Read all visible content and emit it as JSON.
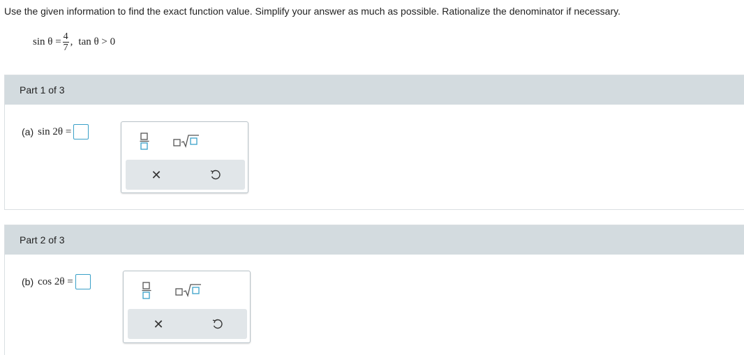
{
  "instructions": "Use the given information to find the exact function value. Simplify your answer as much as possible. Rationalize the denominator if necessary.",
  "given": {
    "lhs": "sin θ =",
    "numerator": "4",
    "denominator": "7",
    "condition": "tan θ > 0"
  },
  "parts": [
    {
      "header": "Part 1 of 3",
      "label": "(a)",
      "expression": "sin 2θ =",
      "answer_value": ""
    },
    {
      "header": "Part 2 of 3",
      "label": "(b)",
      "expression": "cos 2θ =",
      "answer_value": ""
    }
  ],
  "palette_icons": {
    "fraction": "fraction-icon",
    "sqrt": "square-root-icon",
    "clear": "close-icon",
    "undo": "undo-icon"
  },
  "colors": {
    "header_bg": "#d3dbdf",
    "answer_border": "#3aa0c8",
    "palette_tray": "#e1e6e9",
    "icon_accent": "#3aa0c8"
  }
}
